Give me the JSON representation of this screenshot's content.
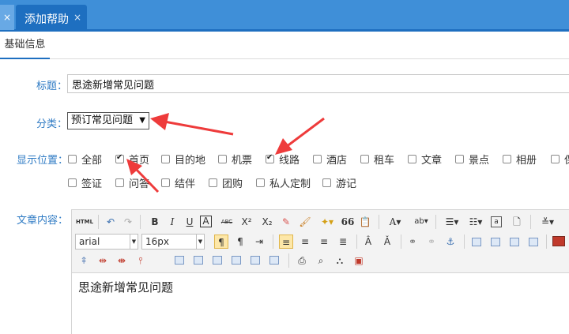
{
  "tabs": {
    "prev_close": "×",
    "active_label": "添加帮助",
    "active_close": "×"
  },
  "subtab": "基础信息",
  "form": {
    "title_label": "标题：",
    "title_value": "思途新增常见问题",
    "category_label": "分类：",
    "category_value": "预订常见问题",
    "display_label": "显示位置：",
    "content_label": "文章内容："
  },
  "positions_row1": [
    {
      "label": "全部",
      "checked": false
    },
    {
      "label": "首页",
      "checked": true
    },
    {
      "label": "目的地",
      "checked": false
    },
    {
      "label": "机票",
      "checked": false
    },
    {
      "label": "线路",
      "checked": true
    },
    {
      "label": "酒店",
      "checked": false
    },
    {
      "label": "租车",
      "checked": false
    },
    {
      "label": "文章",
      "checked": false
    },
    {
      "label": "景点",
      "checked": false
    },
    {
      "label": "相册",
      "checked": false
    },
    {
      "label": "保",
      "checked": false
    }
  ],
  "positions_row2": [
    {
      "label": "签证",
      "checked": false
    },
    {
      "label": "问答",
      "checked": false
    },
    {
      "label": "结伴",
      "checked": false
    },
    {
      "label": "团购",
      "checked": false
    },
    {
      "label": "私人定制",
      "checked": false
    },
    {
      "label": "游记",
      "checked": false
    }
  ],
  "editor": {
    "html_label": "HTML",
    "bold": "B",
    "italic": "I",
    "underline": "U",
    "border_a": "A",
    "strike": "ABC",
    "superscript": "X²",
    "subscript": "X₂",
    "quote": "66",
    "font_color": "A",
    "font_family": "arial",
    "font_size": "16px",
    "content": "思途新增常见问题"
  },
  "colors": {
    "accent": "#1e6fc0",
    "label": "#2f7bc4",
    "arrow": "#ee3b3b"
  }
}
